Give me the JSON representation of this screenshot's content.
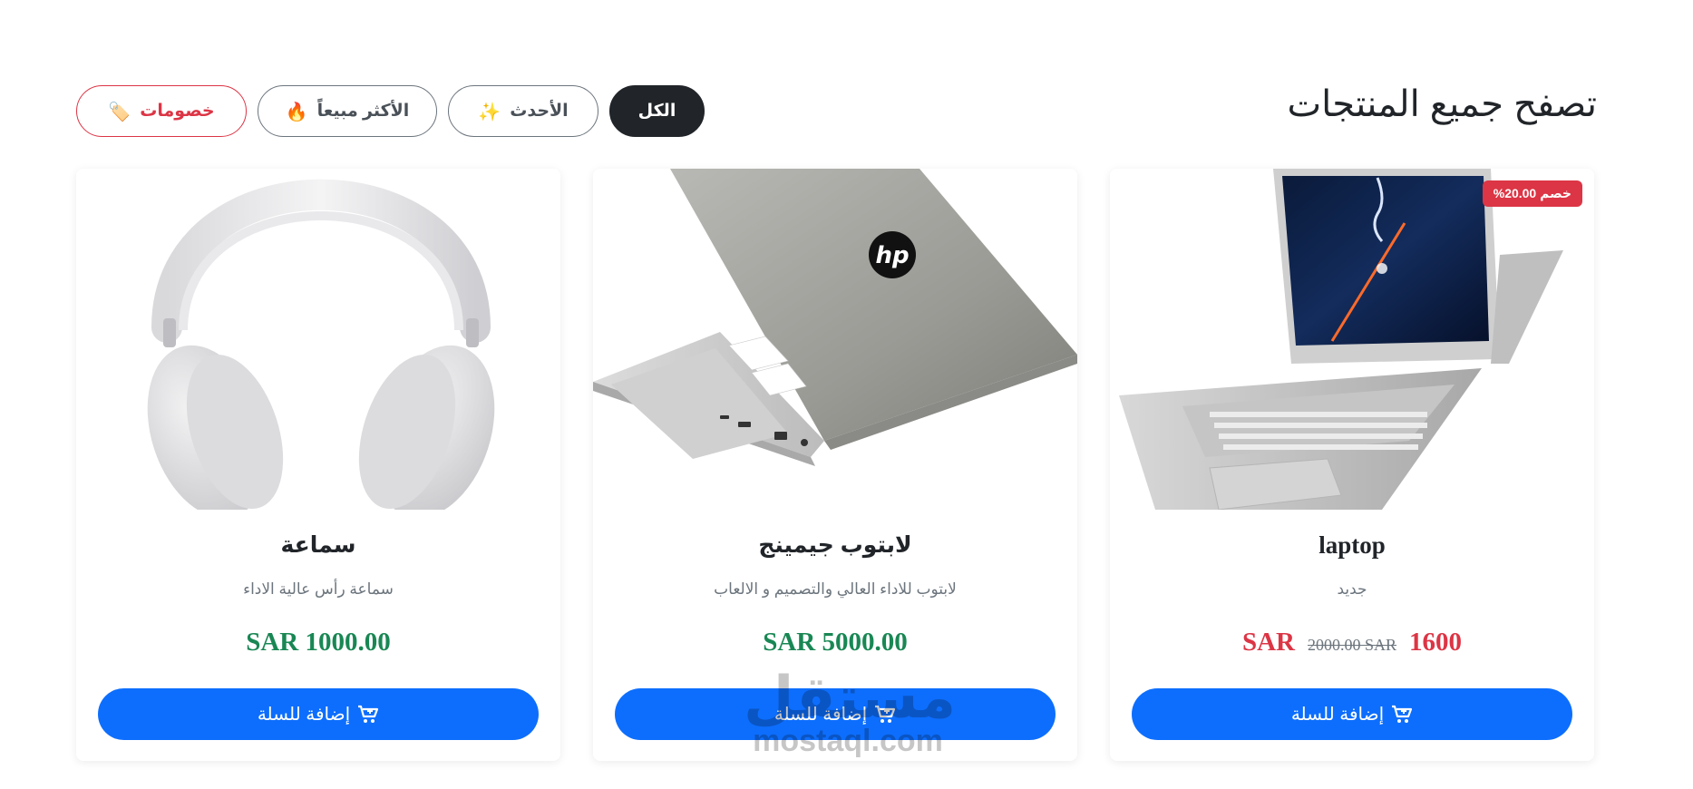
{
  "header": {
    "title": "تصفح جميع المنتجات"
  },
  "filters": {
    "all": "الكل",
    "newest": "الأحدث",
    "newest_icon": "✨",
    "best_selling": "الأكثر مبيعاً",
    "best_selling_icon": "🔥",
    "discounts": "خصومات",
    "discounts_icon": "🏷️"
  },
  "products": [
    {
      "name": "laptop",
      "description": "جديد",
      "badge": "خصم 20.00%",
      "price_sale": "1600",
      "currency": "SAR",
      "price_old": "2000.00 SAR",
      "add_label": "إضافة للسلة",
      "image_icon": "convertible-laptop-image"
    },
    {
      "name": "لابتوب جيمينج",
      "description": "لابتوب للاداء العالي والتصميم و الالعاب",
      "price": "SAR 5000.00",
      "add_label": "إضافة للسلة",
      "image_icon": "hp-laptop-image"
    },
    {
      "name": "سماعة",
      "description": "سماعة رأس عالية الاداء",
      "price": "SAR 1000.00",
      "add_label": "إضافة للسلة",
      "image_icon": "headphones-image"
    }
  ],
  "watermark": {
    "arabic": "مستقل",
    "latin": "mostaql.com"
  },
  "colors": {
    "primary": "#0d6efd",
    "dark": "#212529",
    "danger": "#dc3545",
    "success": "#198754",
    "muted": "#6c757d"
  }
}
